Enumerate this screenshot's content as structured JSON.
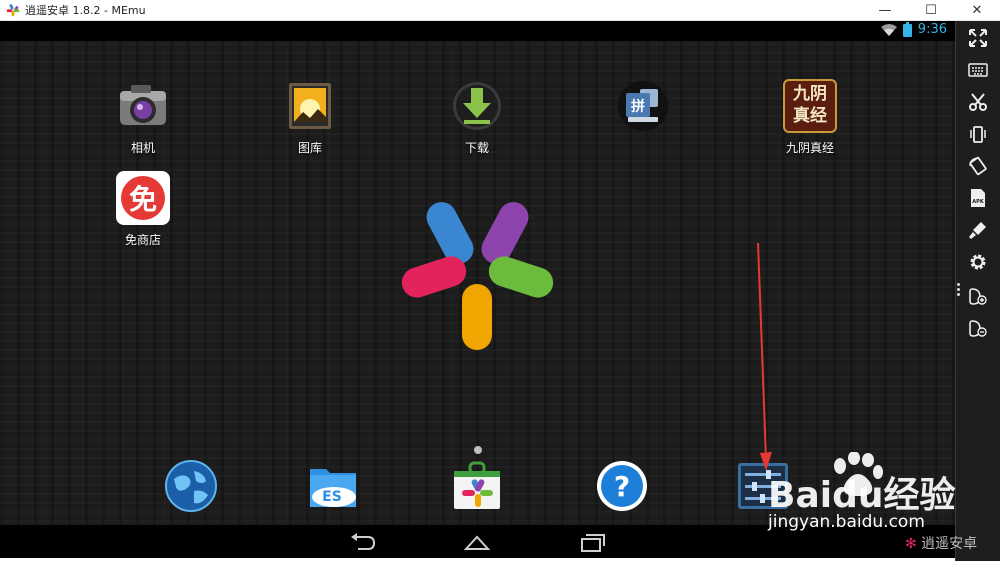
{
  "window": {
    "title": "逍遥安卓 1.8.2 - MEmu",
    "minimize_glyph": "—",
    "maximize_glyph": "☐",
    "close_glyph": "✕"
  },
  "status_bar": {
    "time": "9:36",
    "icons": [
      "wifi-icon",
      "battery-icon"
    ]
  },
  "desktop_apps": [
    {
      "label": "相机",
      "icon": "camera-icon"
    },
    {
      "label": "图库",
      "icon": "gallery-icon"
    },
    {
      "label": "下载",
      "icon": "download-icon"
    },
    {
      "label": "",
      "icon": "pinyin-keyboard-icon",
      "badge": "拼"
    },
    {
      "label": "九阴真经",
      "icon": "game-icon",
      "badge": "九阴真经"
    },
    {
      "label": "免商店",
      "icon": "free-store-icon",
      "badge": "免"
    }
  ],
  "dock": [
    {
      "icon": "browser-globe-icon"
    },
    {
      "icon": "es-file-explorer-icon",
      "badge": "ES"
    },
    {
      "icon": "store-icon"
    },
    {
      "icon": "help-icon",
      "badge": "?"
    },
    {
      "icon": "settings-icon"
    }
  ],
  "nav_bar": [
    "back-icon",
    "home-icon",
    "recents-icon"
  ],
  "sidebar": [
    "fullscreen-icon",
    "keyboard-icon",
    "screenshot-scissors-icon",
    "shake-icon",
    "rotate-icon",
    "apk-install-icon",
    "brush-icon",
    "gear-icon",
    "volume-up-icon",
    "volume-down-icon"
  ],
  "watermark": {
    "brand": "Baidu经验",
    "url": "jingyan.baidu.com",
    "corner": "逍遥安卓"
  },
  "colors": {
    "clock": "#33b5e5",
    "logo_blue": "#3a86d0",
    "logo_purple": "#8e44ad",
    "logo_green": "#6cbb3c",
    "logo_red": "#e3245c",
    "logo_orange": "#f0a500",
    "annotation_arrow": "#e53935"
  }
}
